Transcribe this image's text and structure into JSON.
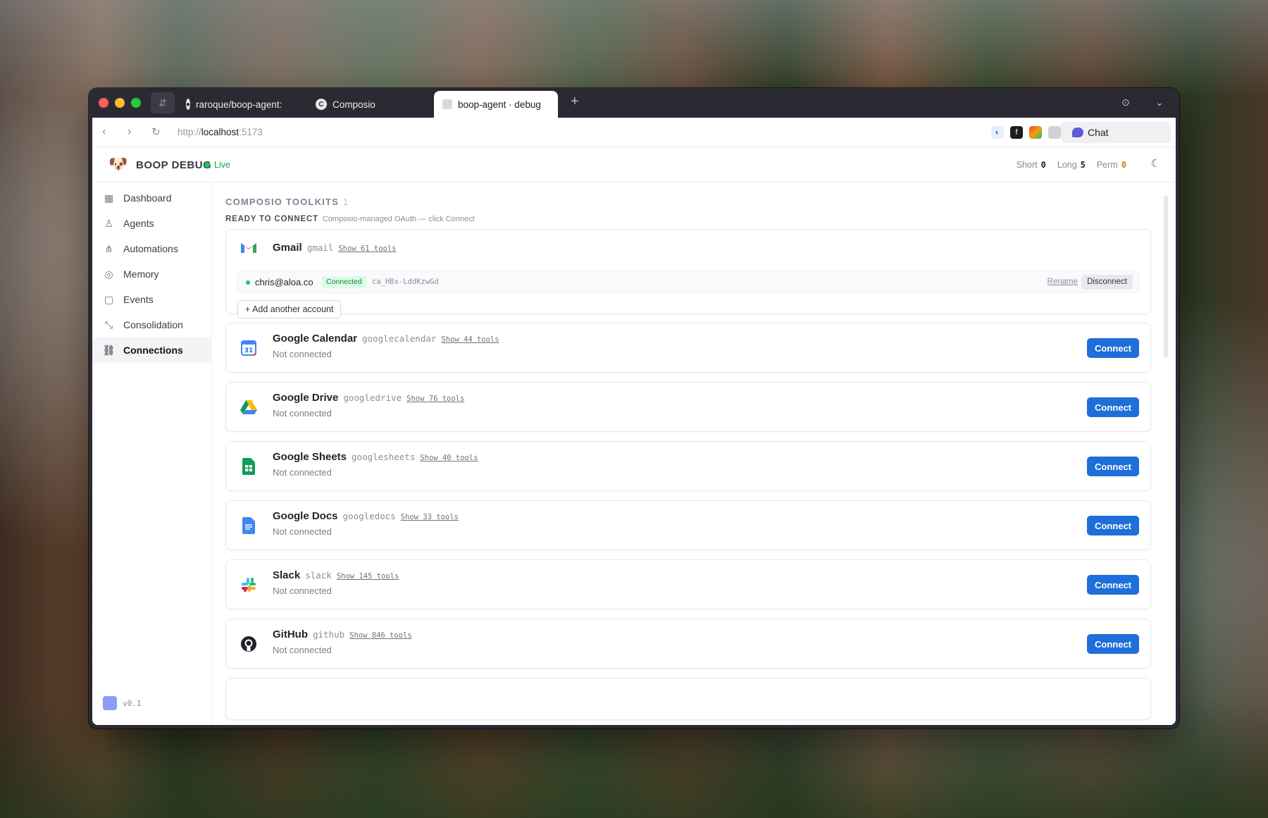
{
  "browser": {
    "tabs": [
      {
        "title": "raroque/boop-agent: T",
        "icon": "github-icon"
      },
      {
        "title": "Composio",
        "icon": "composio-icon"
      },
      {
        "title": "boop-agent · debug",
        "icon": "blank-page-icon"
      }
    ],
    "url_scheme": "http://",
    "url_host": "localhost",
    "url_port": ":5173",
    "chat_label": "Chat"
  },
  "app": {
    "brand": "BOOP DEBUG",
    "live": "Live",
    "counts": [
      {
        "label": "Short",
        "value": "0"
      },
      {
        "label": "Long",
        "value": "5"
      },
      {
        "label": "Perm",
        "value": "0"
      }
    ],
    "version": "v0.1"
  },
  "sidebar": {
    "items": [
      {
        "label": "Dashboard",
        "icon": "grid-icon"
      },
      {
        "label": "Agents",
        "icon": "agent-icon"
      },
      {
        "label": "Automations",
        "icon": "workflow-icon"
      },
      {
        "label": "Memory",
        "icon": "target-icon"
      },
      {
        "label": "Events",
        "icon": "chart-icon"
      },
      {
        "label": "Consolidation",
        "icon": "merge-icon"
      },
      {
        "label": "Connections",
        "icon": "link-icon",
        "active": true
      }
    ]
  },
  "main": {
    "section_title": "COMPOSIO TOOLKITS",
    "section_count": "1",
    "sub_title": "READY TO CONNECT",
    "sub_desc": "Composio-managed OAuth — click Connect",
    "gmail": {
      "name": "Gmail",
      "slug": "gmail",
      "tools": "Show 61 tools",
      "account": {
        "email": "chris@aloa.co",
        "status": "Connected",
        "id": "ca_H8x-LddKzwGd",
        "rename": "Rename",
        "disconnect": "Disconnect"
      },
      "add_account": "+ Add another account"
    },
    "toolkits": [
      {
        "name": "Google Calendar",
        "slug": "googlecalendar",
        "tools": "Show 44 tools",
        "status": "Not connected",
        "button": "Connect",
        "icon": "google-calendar-icon"
      },
      {
        "name": "Google Drive",
        "slug": "googledrive",
        "tools": "Show 76 tools",
        "status": "Not connected",
        "button": "Connect",
        "icon": "google-drive-icon"
      },
      {
        "name": "Google Sheets",
        "slug": "googlesheets",
        "tools": "Show 40 tools",
        "status": "Not connected",
        "button": "Connect",
        "icon": "google-sheets-icon"
      },
      {
        "name": "Google Docs",
        "slug": "googledocs",
        "tools": "Show 33 tools",
        "status": "Not connected",
        "button": "Connect",
        "icon": "google-docs-icon"
      },
      {
        "name": "Slack",
        "slug": "slack",
        "tools": "Show 145 tools",
        "status": "Not connected",
        "button": "Connect",
        "icon": "slack-icon"
      },
      {
        "name": "GitHub",
        "slug": "github",
        "tools": "Show 846 tools",
        "status": "Not connected",
        "button": "Connect",
        "icon": "github-icon"
      }
    ]
  },
  "colors": {
    "accent": "#1e6fd9",
    "live_green": "#22c55e",
    "connected_badge": "#dcfce7",
    "perm_orange": "#d97706"
  }
}
